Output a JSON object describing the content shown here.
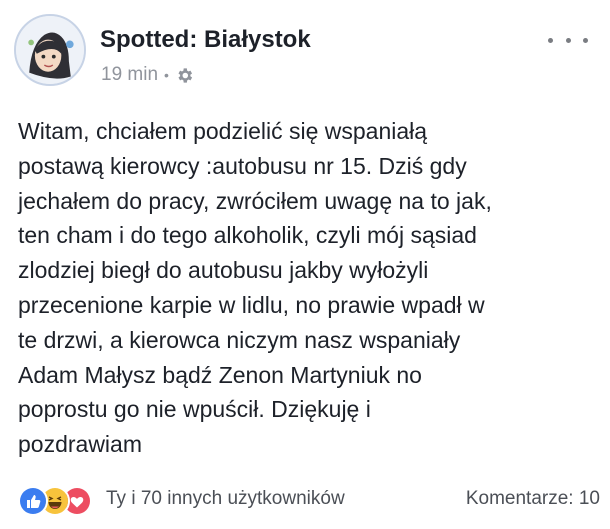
{
  "post": {
    "page_name": "Spotted: Białystok",
    "time": "19 min",
    "separator": "•",
    "privacy_icon": "gear-icon",
    "more_icon": "more-options-icon",
    "lines": [
      "Witam, chciałem podzielić się wspaniałą",
      "postawą kierowcy :autobusu nr 15. Dziś gdy",
      "jechałem do pracy, zwróciłem uwagę na to jak,",
      "ten cham i do tego alkoholik, czyli mój sąsiad",
      "zlodziej biegł do autobusu jakby wyłożyli",
      "przecenione karpie w lidlu, no prawie wpadł w",
      "te drzwi, a kierowca niczym nasz wspaniały",
      "Adam Małysz bądź Zenon Martyniuk no",
      "poprostu go nie wpuścił. Dziękuję i",
      "pozdrawiam"
    ]
  },
  "footer": {
    "reactions": [
      "like-icon",
      "haha-icon",
      "love-icon"
    ],
    "reactors_text": "Ty i 70 innych użytkowników",
    "comments_text": "Komentarze: 10"
  },
  "colors": {
    "text": "#1d2129",
    "meta": "#90949c",
    "like_blue": "#3b7df0",
    "haha_yellow": "#f7c33c",
    "love_red": "#ed4d61"
  }
}
